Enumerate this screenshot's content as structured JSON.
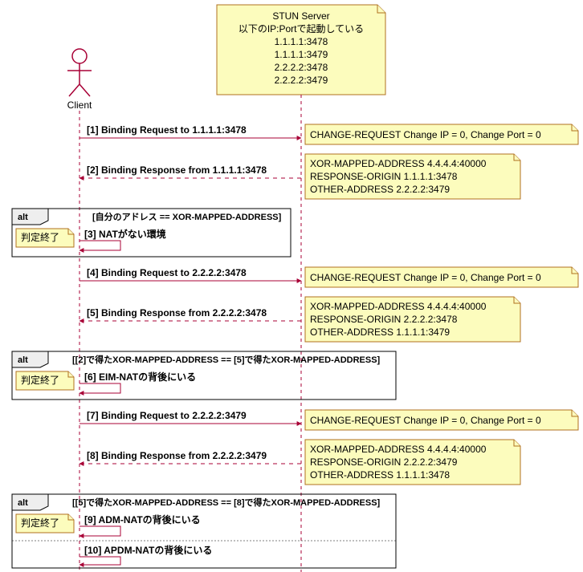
{
  "actors": {
    "client": "Client",
    "server_title": "STUN Server",
    "server_sub": "以下のIP:Portで起動している",
    "server_ips": [
      "1.1.1.1:3478",
      "1.1.1.1:3479",
      "2.2.2.2:3478",
      "2.2.2.2:3479"
    ]
  },
  "messages": {
    "m1": "[1] Binding Request to 1.1.1.1:3478",
    "m2": "[2] Binding Response from 1.1.1.1:3478",
    "m3": "[3] NATがない環境",
    "m4": "[4] Binding Request to 2.2.2.2:3478",
    "m5": "[5] Binding Response from 2.2.2.2:3478",
    "m6": "[6] EIM-NATの背後にいる",
    "m7": "[7] Binding Request to 2.2.2.2:3479",
    "m8": "[8] Binding Response from 2.2.2.2:3479",
    "m9": "[9] ADM-NATの背後にいる",
    "m10": "[10] APDM-NATの背後にいる"
  },
  "notes": {
    "n1": "CHANGE-REQUEST Change IP = 0, Change Port = 0",
    "n2a": "XOR-MAPPED-ADDRESS 4.4.4.4:40000",
    "n2b": "RESPONSE-ORIGIN 1.1.1.1:3478",
    "n2c": "OTHER-ADDRESS 2.2.2.2:3479",
    "n4": "CHANGE-REQUEST Change IP = 0, Change Port = 0",
    "n5a": "XOR-MAPPED-ADDRESS 4.4.4.4:40000",
    "n5b": "RESPONSE-ORIGIN 2.2.2.2:3478",
    "n5c": "OTHER-ADDRESS 1.1.1.1:3479",
    "n7": "CHANGE-REQUEST Change IP = 0, Change Port = 0",
    "n8a": "XOR-MAPPED-ADDRESS 4.4.4.4:40000",
    "n8b": "RESPONSE-ORIGIN 2.2.2.2:3479",
    "n8c": "OTHER-ADDRESS 1.1.1.1:3478",
    "judge": "判定終了"
  },
  "alts": {
    "label": "alt",
    "cond1": "[自分のアドレス == XOR-MAPPED-ADDRESS]",
    "cond2": "[[2]で得たXOR-MAPPED-ADDRESS == [5]で得たXOR-MAPPED-ADDRESS]",
    "cond3": "[[5]で得たXOR-MAPPED-ADDRESS == [8]で得たXOR-MAPPED-ADDRESS]"
  },
  "chart_data": {
    "type": "sequence-diagram",
    "participants": [
      {
        "name": "Client",
        "kind": "actor"
      },
      {
        "name": "STUN Server",
        "kind": "participant",
        "endpoints": [
          "1.1.1.1:3478",
          "1.1.1.1:3479",
          "2.2.2.2:3478",
          "2.2.2.2:3479"
        ]
      }
    ],
    "events": [
      {
        "n": 1,
        "from": "Client",
        "to": "STUN Server",
        "label": "Binding Request to 1.1.1.1:3478",
        "note": "CHANGE-REQUEST Change IP = 0, Change Port = 0"
      },
      {
        "n": 2,
        "from": "STUN Server",
        "to": "Client",
        "label": "Binding Response from 1.1.1.1:3478",
        "note": [
          "XOR-MAPPED-ADDRESS 4.4.4.4:40000",
          "RESPONSE-ORIGIN 1.1.1.1:3478",
          "OTHER-ADDRESS 2.2.2.2:3479"
        ]
      },
      {
        "alt": "自分のアドレス == XOR-MAPPED-ADDRESS",
        "branches": [
          {
            "n": 3,
            "self": "Client",
            "label": "NATがない環境",
            "note": "判定終了"
          }
        ]
      },
      {
        "n": 4,
        "from": "Client",
        "to": "STUN Server",
        "label": "Binding Request to 2.2.2.2:3478",
        "note": "CHANGE-REQUEST Change IP = 0, Change Port = 0"
      },
      {
        "n": 5,
        "from": "STUN Server",
        "to": "Client",
        "label": "Binding Response from 2.2.2.2:3478",
        "note": [
          "XOR-MAPPED-ADDRESS 4.4.4.4:40000",
          "RESPONSE-ORIGIN 2.2.2.2:3478",
          "OTHER-ADDRESS 1.1.1.1:3479"
        ]
      },
      {
        "alt": "[2]で得たXOR-MAPPED-ADDRESS == [5]で得たXOR-MAPPED-ADDRESS",
        "branches": [
          {
            "n": 6,
            "self": "Client",
            "label": "EIM-NATの背後にいる",
            "note": "判定終了"
          }
        ]
      },
      {
        "n": 7,
        "from": "Client",
        "to": "STUN Server",
        "label": "Binding Request to 2.2.2.2:3479",
        "note": "CHANGE-REQUEST Change IP = 0, Change Port = 0"
      },
      {
        "n": 8,
        "from": "STUN Server",
        "to": "Client",
        "label": "Binding Response from 2.2.2.2:3479",
        "note": [
          "XOR-MAPPED-ADDRESS 4.4.4.4:40000",
          "RESPONSE-ORIGIN 2.2.2.2:3479",
          "OTHER-ADDRESS 1.1.1.1:3478"
        ]
      },
      {
        "alt": "[5]で得たXOR-MAPPED-ADDRESS == [8]で得たXOR-MAPPED-ADDRESS",
        "branches": [
          {
            "n": 9,
            "self": "Client",
            "label": "ADM-NATの背後にいる",
            "note": "判定終了"
          },
          {
            "else": true,
            "n": 10,
            "self": "Client",
            "label": "APDM-NATの背後にいる"
          }
        ]
      }
    ]
  }
}
